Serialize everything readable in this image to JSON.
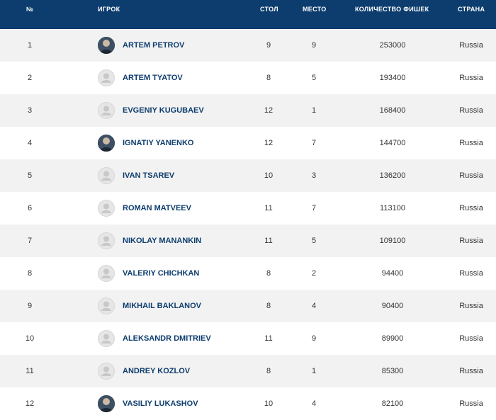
{
  "header": {
    "num": "№",
    "player": "ИГРОК",
    "table": "СТОЛ",
    "seat": "МЕСТО",
    "chips": "КОЛИЧЕСТВО ФИШЕК",
    "country": "СТРАНА"
  },
  "colors": {
    "header_bg": "#0d3d6e",
    "name_color": "#0d3d6e",
    "row_alt": "#f2f2f2"
  },
  "rows": [
    {
      "num": "1",
      "name": "ARTEM PETROV",
      "table": "9",
      "seat": "9",
      "chips": "253000",
      "country": "Russia",
      "avatar": "photo"
    },
    {
      "num": "2",
      "name": "ARTEM TYATOV",
      "table": "8",
      "seat": "5",
      "chips": "193400",
      "country": "Russia",
      "avatar": "default"
    },
    {
      "num": "3",
      "name": "EVGENIY KUGUBAEV",
      "table": "12",
      "seat": "1",
      "chips": "168400",
      "country": "Russia",
      "avatar": "default"
    },
    {
      "num": "4",
      "name": "IGNATIY YANENKO",
      "table": "12",
      "seat": "7",
      "chips": "144700",
      "country": "Russia",
      "avatar": "photo"
    },
    {
      "num": "5",
      "name": "IVAN TSAREV",
      "table": "10",
      "seat": "3",
      "chips": "136200",
      "country": "Russia",
      "avatar": "default"
    },
    {
      "num": "6",
      "name": "ROMAN MATVEEV",
      "table": "11",
      "seat": "7",
      "chips": "113100",
      "country": "Russia",
      "avatar": "default"
    },
    {
      "num": "7",
      "name": "NIKOLAY MANANKIN",
      "table": "11",
      "seat": "5",
      "chips": "109100",
      "country": "Russia",
      "avatar": "default"
    },
    {
      "num": "8",
      "name": "VALERIY CHICHKAN",
      "table": "8",
      "seat": "2",
      "chips": "94400",
      "country": "Russia",
      "avatar": "default"
    },
    {
      "num": "9",
      "name": "MIKHAIL BAKLANOV",
      "table": "8",
      "seat": "4",
      "chips": "90400",
      "country": "Russia",
      "avatar": "default"
    },
    {
      "num": "10",
      "name": "ALEKSANDR DMITRIEV",
      "table": "11",
      "seat": "9",
      "chips": "89900",
      "country": "Russia",
      "avatar": "default"
    },
    {
      "num": "11",
      "name": "ANDREY KOZLOV",
      "table": "8",
      "seat": "1",
      "chips": "85300",
      "country": "Russia",
      "avatar": "default"
    },
    {
      "num": "12",
      "name": "VASILIY LUKASHOV",
      "table": "10",
      "seat": "4",
      "chips": "82100",
      "country": "Russia",
      "avatar": "photo"
    }
  ]
}
